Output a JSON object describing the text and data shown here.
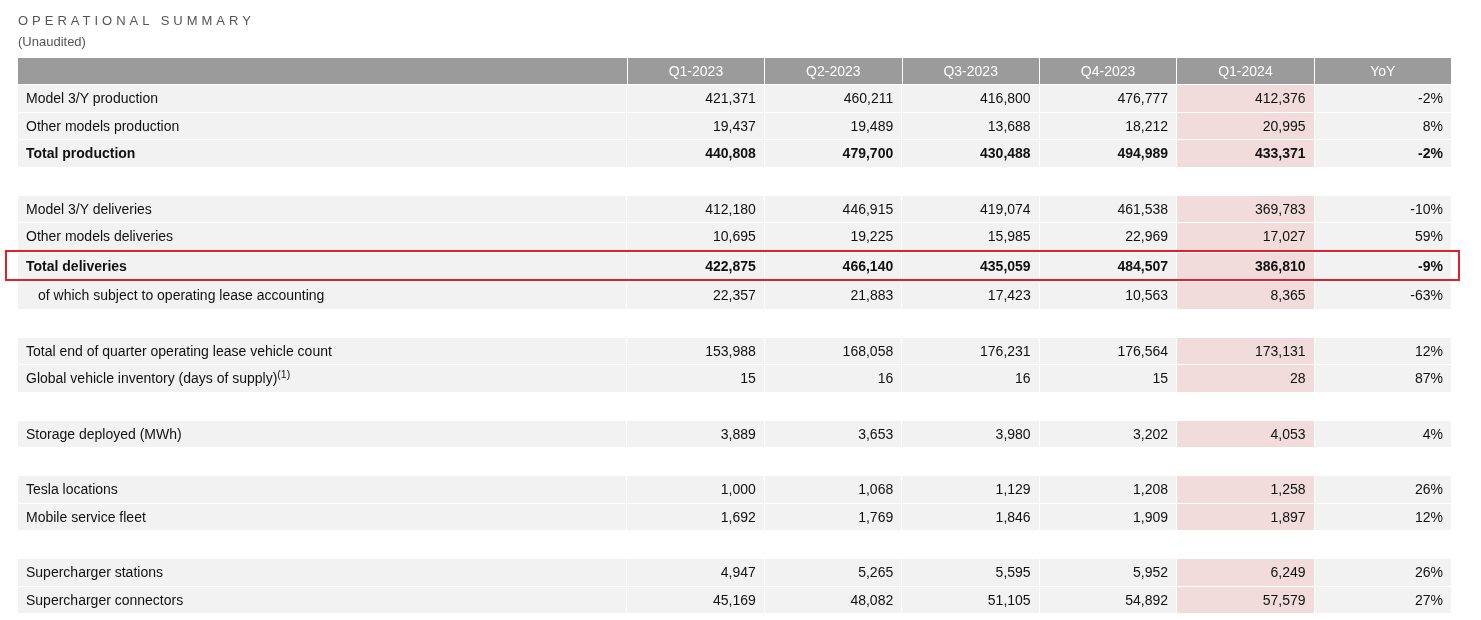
{
  "title": "OPERATIONAL SUMMARY",
  "subtitle": "(Unaudited)",
  "columns": [
    {
      "label": "Q1-2023",
      "highlighted": false
    },
    {
      "label": "Q2-2023",
      "highlighted": false
    },
    {
      "label": "Q3-2023",
      "highlighted": false
    },
    {
      "label": "Q4-2023",
      "highlighted": false
    },
    {
      "label": "Q1-2024",
      "highlighted": true
    },
    {
      "label": "YoY",
      "highlighted": false
    }
  ],
  "groups": [
    {
      "rows": [
        {
          "label": "Model 3/Y production",
          "bold": false,
          "outlined": false,
          "values": [
            "421,371",
            "460,211",
            "416,800",
            "476,777",
            "412,376",
            "-2%"
          ]
        },
        {
          "label": "Other models production",
          "bold": false,
          "outlined": false,
          "values": [
            "19,437",
            "19,489",
            "13,688",
            "18,212",
            "20,995",
            "8%"
          ]
        },
        {
          "label": "Total production",
          "bold": true,
          "outlined": false,
          "values": [
            "440,808",
            "479,700",
            "430,488",
            "494,989",
            "433,371",
            "-2%"
          ]
        }
      ]
    },
    {
      "rows": [
        {
          "label": "Model 3/Y deliveries",
          "bold": false,
          "outlined": false,
          "values": [
            "412,180",
            "446,915",
            "419,074",
            "461,538",
            "369,783",
            "-10%"
          ]
        },
        {
          "label": "Other models deliveries",
          "bold": false,
          "outlined": false,
          "values": [
            "10,695",
            "19,225",
            "15,985",
            "22,969",
            "17,027",
            "59%"
          ]
        },
        {
          "label": "Total deliveries",
          "bold": true,
          "outlined": true,
          "values": [
            "422,875",
            "466,140",
            "435,059",
            "484,507",
            "386,810",
            "-9%"
          ],
          "children": [
            {
              "label": "of which subject to operating lease accounting",
              "bold": false,
              "outlined": false,
              "values": [
                "22,357",
                "21,883",
                "17,423",
                "10,563",
                "8,365",
                "-63%"
              ]
            }
          ]
        }
      ]
    },
    {
      "rows": [
        {
          "label": "Total end of quarter operating lease vehicle count",
          "bold": false,
          "outlined": false,
          "values": [
            "153,988",
            "168,058",
            "176,231",
            "176,564",
            "173,131",
            "12%"
          ]
        },
        {
          "label": "Global vehicle inventory (days of supply)$^{(1)}$",
          "bold": false,
          "outlined": false,
          "values": [
            "15",
            "16",
            "16",
            "15",
            "28",
            "87%"
          ]
        }
      ]
    },
    {
      "rows": [
        {
          "label": "Storage deployed (MWh)",
          "bold": false,
          "outlined": false,
          "values": [
            "3,889",
            "3,653",
            "3,980",
            "3,202",
            "4,053",
            "4%"
          ]
        }
      ]
    },
    {
      "rows": [
        {
          "label": "Tesla locations",
          "bold": false,
          "outlined": false,
          "values": [
            "1,000",
            "1,068",
            "1,129",
            "1,208",
            "1,258",
            "26%"
          ]
        },
        {
          "label": "Mobile service fleet",
          "bold": false,
          "outlined": false,
          "values": [
            "1,692",
            "1,769",
            "1,846",
            "1,909",
            "1,897",
            "12%"
          ]
        }
      ]
    },
    {
      "rows": [
        {
          "label": "Supercharger stations",
          "bold": false,
          "outlined": false,
          "values": [
            "4,947",
            "5,265",
            "5,595",
            "5,952",
            "6,249",
            "26%"
          ]
        },
        {
          "label": "Supercharger connectors",
          "bold": false,
          "outlined": false,
          "values": [
            "45,169",
            "48,082",
            "51,105",
            "54,892",
            "57,579",
            "27%"
          ]
        }
      ]
    }
  ]
}
